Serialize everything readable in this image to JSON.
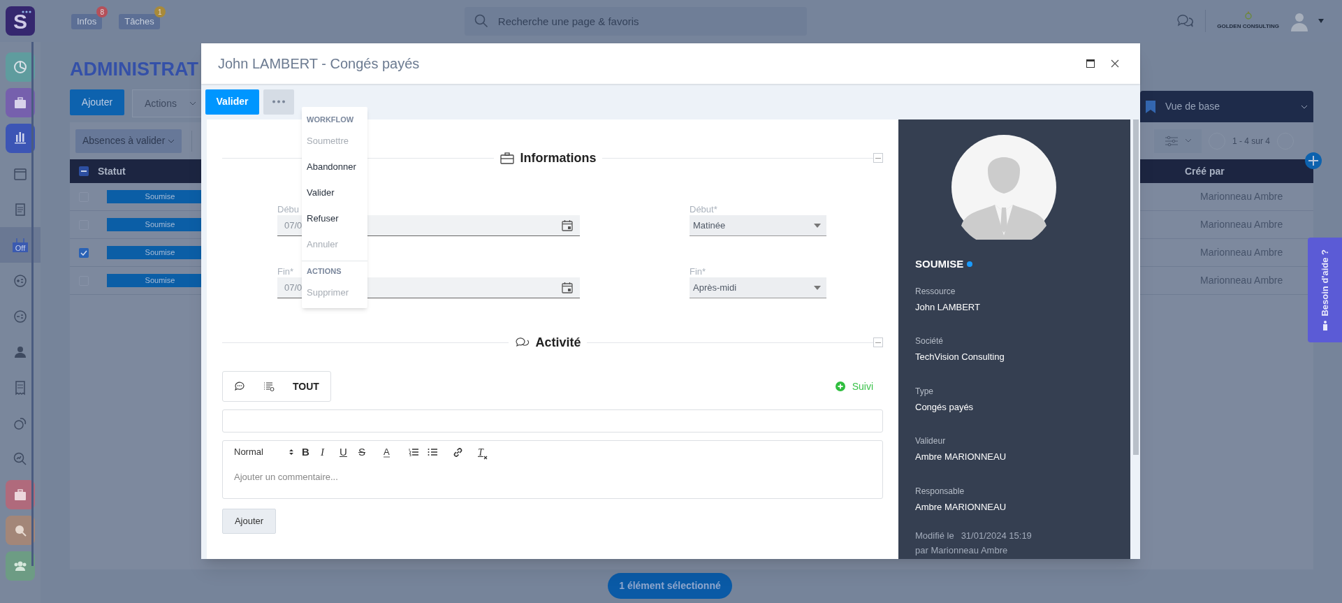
{
  "top_bar": {
    "logo": "S",
    "buttons": [
      {
        "label": "Infos",
        "badge": "8",
        "color": "#b5505a"
      },
      {
        "label": "Tâches",
        "badge": "1",
        "color": "#a88a3a"
      }
    ],
    "search": {
      "placeholder": "Recherche une page & favoris"
    },
    "company": "GOLDEN CONSULTING"
  },
  "sidebar": {
    "items": [
      {
        "kind": "tile",
        "color": "#5f9c9e",
        "selected": false
      },
      {
        "kind": "tile",
        "color": "#7660ad",
        "selected": false
      },
      {
        "kind": "tile",
        "color": "#3c55b5",
        "selected": false
      },
      {
        "kind": "plain",
        "selected": false
      },
      {
        "kind": "plain",
        "selected": false
      },
      {
        "kind": "plain",
        "selected": true,
        "label": "Off"
      },
      {
        "kind": "plain",
        "selected": false
      },
      {
        "kind": "plain",
        "selected": false
      },
      {
        "kind": "plain",
        "selected": false
      },
      {
        "kind": "plain",
        "selected": false
      },
      {
        "kind": "plain",
        "selected": false
      },
      {
        "kind": "plain",
        "selected": false
      },
      {
        "kind": "tile",
        "color": "#b06a7c",
        "selected": false
      },
      {
        "kind": "tile",
        "color": "#a38678",
        "selected": false
      },
      {
        "kind": "tile",
        "color": "#6d9c84",
        "selected": false
      }
    ]
  },
  "page": {
    "title": "ADMINISTRAT",
    "add_button": "Ajouter",
    "actions_button": "Actions",
    "filter": "Absences à valider",
    "view": "Vue de base",
    "pager": "1 - 4 sur 4"
  },
  "table": {
    "columns": [
      "Statut",
      "Créé par"
    ],
    "header_partial": true,
    "rows": [
      {
        "checked": false,
        "status": "Soumise",
        "created_by": "Marionneau Ambre"
      },
      {
        "checked": false,
        "status": "Soumise",
        "created_by": "Marionneau Ambre"
      },
      {
        "checked": true,
        "status": "Soumise",
        "created_by": "Marionneau Ambre"
      },
      {
        "checked": false,
        "status": "Soumise",
        "created_by": "Marionneau Ambre"
      }
    ]
  },
  "selection_bar": "1 élément sélectionné",
  "help_tab": "Besoin d'aide ?",
  "modal": {
    "title": "John LAMBERT - Congés payés",
    "primary_button": "Valider",
    "menu": [
      {
        "kind": "header",
        "label": "WORKFLOW"
      },
      {
        "kind": "item",
        "label": "Soumettre",
        "disabled": true
      },
      {
        "kind": "item",
        "label": "Abandonner",
        "disabled": false
      },
      {
        "kind": "item",
        "label": "Valider",
        "disabled": false
      },
      {
        "kind": "item",
        "label": "Refuser",
        "disabled": false
      },
      {
        "kind": "item",
        "label": "Annuler",
        "disabled": true
      },
      {
        "kind": "header",
        "label": "ACTIONS"
      },
      {
        "kind": "item",
        "label": "Supprimer",
        "disabled": true
      }
    ],
    "informations": {
      "title": "Informations",
      "fields": [
        {
          "kind": "date",
          "label": "Débu",
          "value": "07/0"
        },
        {
          "kind": "select",
          "label": "Début*",
          "value": "Matinée"
        },
        {
          "kind": "date",
          "label": "Fin*",
          "value": "07/0"
        },
        {
          "kind": "select",
          "label": "Fin*",
          "value": "Après-midi"
        }
      ]
    },
    "activity": {
      "title": "Activité",
      "tab_label": "TOUT",
      "follow": "Suivi",
      "format": "Normal",
      "tools": [
        {
          "kind": "bold",
          "label": "B"
        },
        {
          "kind": "italic",
          "label": "I"
        },
        {
          "kind": "underline",
          "label": "U"
        },
        {
          "kind": "strike",
          "label": "S"
        },
        {
          "kind": "color",
          "label": "A"
        },
        {
          "kind": "ordered-list"
        },
        {
          "kind": "bullet-list"
        },
        {
          "kind": "link"
        },
        {
          "kind": "clear",
          "label": "T"
        }
      ],
      "comment_placeholder": "Ajouter un commentaire...",
      "add_button": "Ajouter"
    },
    "side_panel": {
      "status": {
        "label": "SOUMISE",
        "color": "#1a9bff"
      },
      "fields": [
        {
          "label": "Ressource",
          "value": "John LAMBERT"
        },
        {
          "label": "Société",
          "value": "TechVision Consulting"
        },
        {
          "label": "Type",
          "value": "Congés payés"
        },
        {
          "label": "Valideur",
          "value": "Ambre MARIONNEAU"
        },
        {
          "label": "Responsable",
          "value": "Ambre MARIONNEAU"
        }
      ],
      "modified_label": "Modifié le",
      "modified_date": "31/01/2024 15:19",
      "modified_by": "par Marionneau Ambre"
    }
  }
}
